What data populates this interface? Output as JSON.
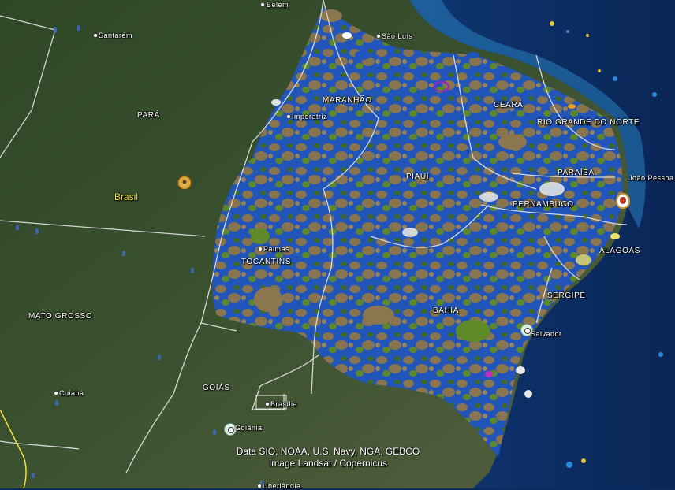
{
  "map": {
    "country_label": "Brasil",
    "states": [
      {
        "id": "para",
        "label": "PARÁ"
      },
      {
        "id": "maranhao",
        "label": "MARANHÃO"
      },
      {
        "id": "ceara",
        "label": "CEARÁ"
      },
      {
        "id": "rio-grande-do-norte",
        "label": "RIO GRANDE DO NORTE"
      },
      {
        "id": "paraiba",
        "label": "PARAÍBA"
      },
      {
        "id": "piaui",
        "label": "PIAUÍ"
      },
      {
        "id": "pernambuco",
        "label": "PERNAMBUCO"
      },
      {
        "id": "alagoas",
        "label": "ALAGOAS"
      },
      {
        "id": "sergipe",
        "label": "SERGIPE"
      },
      {
        "id": "tocantins",
        "label": "TOCANTINS"
      },
      {
        "id": "bahia",
        "label": "BAHIA"
      },
      {
        "id": "mato-grosso",
        "label": "MATO GROSSO"
      },
      {
        "id": "goias",
        "label": "GOIÁS"
      }
    ],
    "cities": [
      {
        "id": "belem",
        "label": "Belém"
      },
      {
        "id": "santarem",
        "label": "Santarém"
      },
      {
        "id": "sao-luis",
        "label": "São Luís"
      },
      {
        "id": "imperatriz",
        "label": "Imperatriz"
      },
      {
        "id": "joao-pessoa",
        "label": "João Pessoa"
      },
      {
        "id": "palmas",
        "label": "Palmas"
      },
      {
        "id": "salvador",
        "label": "Salvador"
      },
      {
        "id": "cuiaba",
        "label": "Cuiabá"
      },
      {
        "id": "brasilia",
        "label": "Brasília"
      },
      {
        "id": "goiania",
        "label": "Goiânia"
      },
      {
        "id": "uberlandia",
        "label": "Uberlândia"
      }
    ],
    "attribution": {
      "line1": "Data SIO, NOAA, U.S. Navy, NGA, GEBCO",
      "line2": "Image Landsat / Copernicus"
    }
  },
  "colors": {
    "forest": "#2f4a26",
    "savanna": "#4f5e3a",
    "ocean_deep": "#0b2a5e",
    "ocean_shelf": "#1d6aa6",
    "water_blue": "#1f5fc4",
    "soil_brown": "#8c7650",
    "vegetation_green": "#5f8a2a",
    "border_white": "#e6e6e6",
    "country_label": "#f2e23a"
  }
}
